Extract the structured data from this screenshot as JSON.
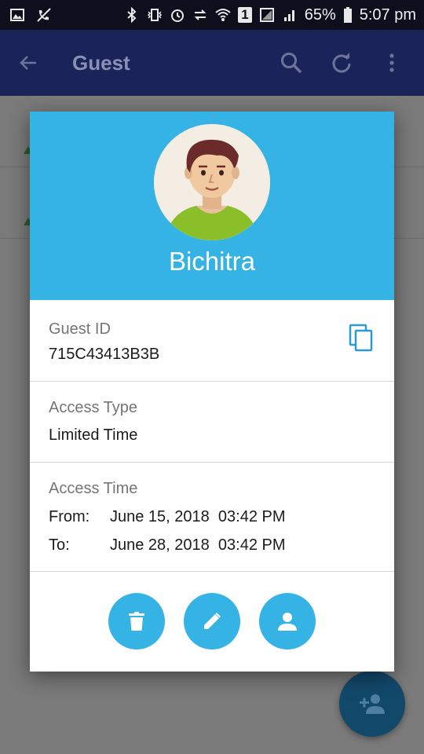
{
  "status_bar": {
    "battery": "65%",
    "time": "5:07 pm",
    "sim_slot": "1",
    "icons": [
      "image-icon",
      "mute-call-icon",
      "bluetooth-icon",
      "vibrate-icon",
      "alarm-icon",
      "data-transfer-icon",
      "wifi-icon",
      "sim-icon",
      "signal-icon",
      "battery-icon"
    ]
  },
  "toolbar": {
    "title": "Guest",
    "icons": [
      "back-arrow-icon",
      "search-icon",
      "refresh-icon",
      "more-vert-icon"
    ]
  },
  "dialog": {
    "name": "Bichitra",
    "guest_id": {
      "label": "Guest ID",
      "value": "715C43413B3B"
    },
    "access_type": {
      "label": "Access Type",
      "value": "Limited Time"
    },
    "access_time": {
      "label": "Access Time",
      "from_label": "From:",
      "from_value": "June 15, 2018  03:42 PM",
      "to_label": "To:",
      "to_value": "June 28, 2018  03:42 PM"
    },
    "actions": [
      "delete-icon",
      "edit-icon",
      "person-icon"
    ]
  },
  "fab": {
    "icon": "add-person-icon"
  },
  "colors": {
    "header": "#34b3e4",
    "toolbar": "#1b2459",
    "fab": "#12496b",
    "statusbar": "#0d0f1c"
  }
}
